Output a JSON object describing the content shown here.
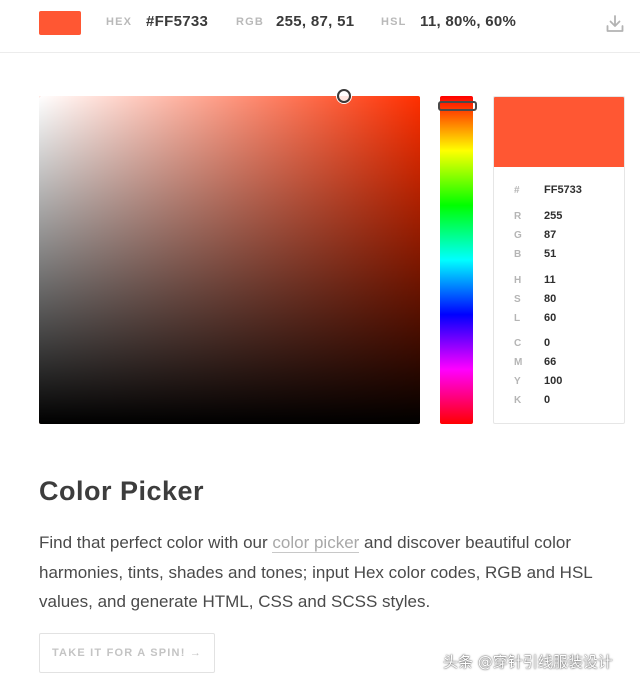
{
  "color": {
    "hex": "#FF5733",
    "hue_deg": 11,
    "saturation_hsv": 0.8,
    "value_hsv": 1.0
  },
  "topbar": {
    "hex_label": "HEX",
    "hex_value": "#FF5733",
    "rgb_label": "RGB",
    "rgb_value": "255, 87, 51",
    "hsl_label": "HSL",
    "hsl_value": "11, 80%, 60%",
    "download_icon": "download-icon"
  },
  "info": {
    "hash": {
      "label": "#",
      "value": "FF5733"
    },
    "r": {
      "label": "R",
      "value": "255"
    },
    "g": {
      "label": "G",
      "value": "87"
    },
    "b": {
      "label": "B",
      "value": "51"
    },
    "h": {
      "label": "H",
      "value": "11"
    },
    "s": {
      "label": "S",
      "value": "80"
    },
    "l": {
      "label": "L",
      "value": "60"
    },
    "c": {
      "label": "C",
      "value": "0"
    },
    "m": {
      "label": "M",
      "value": "66"
    },
    "y": {
      "label": "Y",
      "value": "100"
    },
    "k": {
      "label": "K",
      "value": "0"
    }
  },
  "content": {
    "title": "Color Picker",
    "desc_before": "Find that perfect color with our ",
    "desc_link": "color picker",
    "desc_after": " and discover beautiful color harmonies, tints, shades and tones; input Hex color codes, RGB and HSL values, and generate HTML, CSS and SCSS styles.",
    "cta": "TAKE IT FOR A SPIN! →"
  },
  "watermark": "头条 @穿针引线服装设计"
}
